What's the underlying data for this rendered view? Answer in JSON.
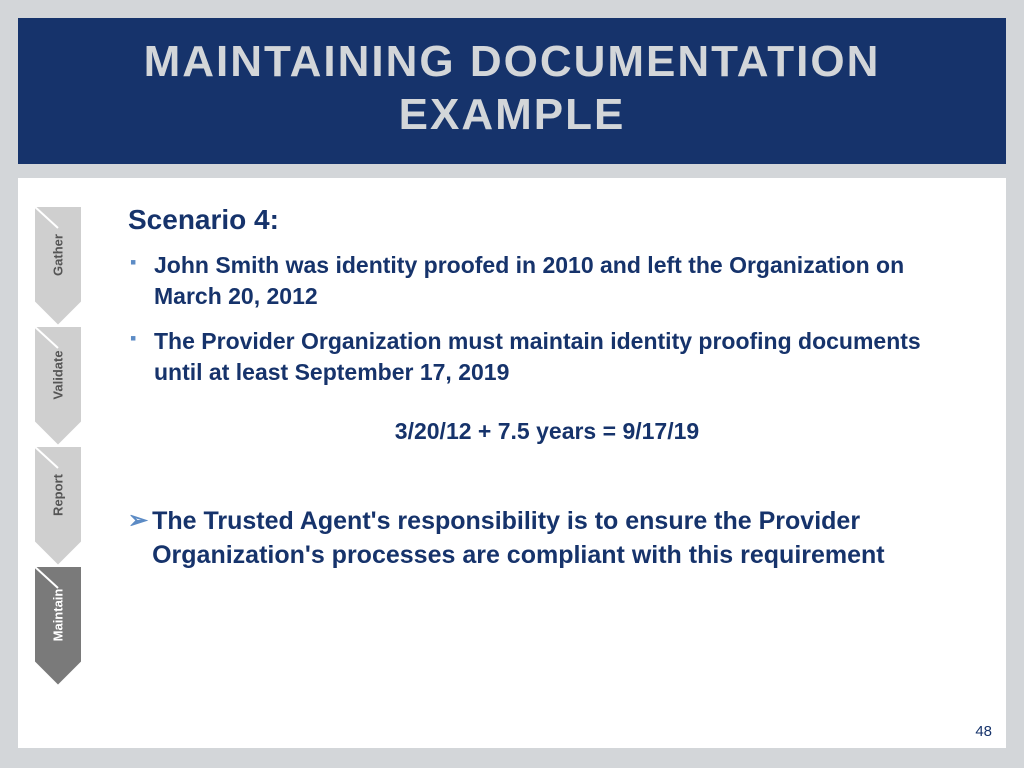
{
  "title": "MAINTAINING DOCUMENTATION EXAMPLE",
  "chevrons": [
    {
      "label": "Gather",
      "fill": "#cfcfcf",
      "active": false
    },
    {
      "label": "Validate",
      "fill": "#cfcfcf",
      "active": false
    },
    {
      "label": "Report",
      "fill": "#cfcfcf",
      "active": false
    },
    {
      "label": "Maintain",
      "fill": "#7a7a7a",
      "active": true
    }
  ],
  "scenario_title": "Scenario 4:",
  "bullets": [
    "John Smith was identity proofed in 2010 and left the Organization on March 20, 2012",
    "The Provider Organization must maintain identity proofing documents until at least September 17, 2019"
  ],
  "equation": "3/20/12 + 7.5 years = 9/17/19",
  "arrow_text": "The Trusted Agent's responsibility is to ensure the Provider Organization's processes  are compliant with this requirement",
  "page_number": "48"
}
